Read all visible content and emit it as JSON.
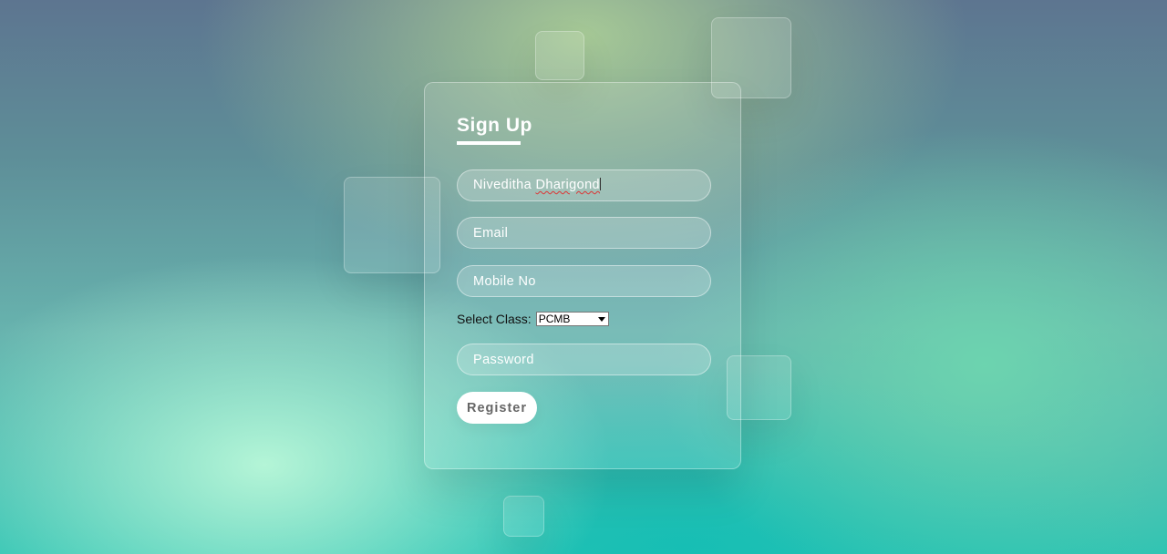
{
  "form": {
    "title": "Sign Up",
    "name_value_part1": "Niveditha ",
    "name_value_part2": "Dharigond",
    "email_placeholder": "Email",
    "mobile_placeholder": "Mobile No",
    "class_label": "Select Class:",
    "class_selected": "PCMB",
    "password_placeholder": "Password",
    "register_label": "Register"
  },
  "colors": {
    "accent": "#ffffff",
    "button_text": "#666666",
    "spellcheck_underline": "#dd3333"
  }
}
